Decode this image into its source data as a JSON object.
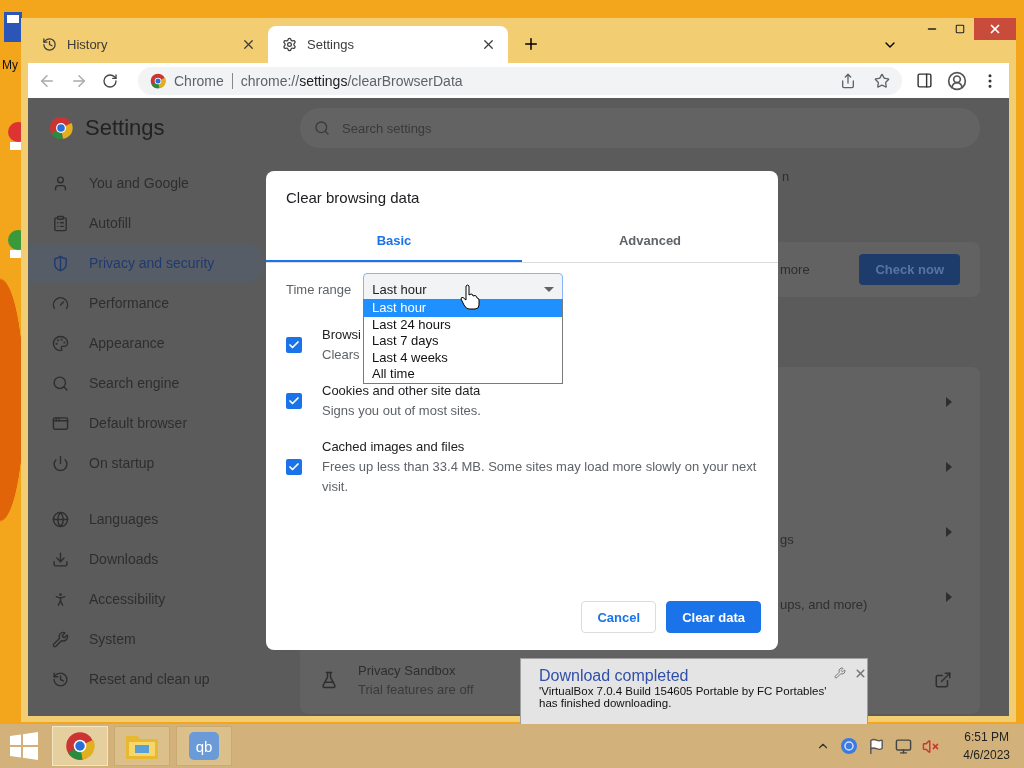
{
  "desktop": {
    "icon_label": "My"
  },
  "browser": {
    "tabs": [
      {
        "title": "History",
        "selected": false
      },
      {
        "title": "Settings",
        "selected": true
      }
    ],
    "omnibox": {
      "site": "Chrome",
      "url": "chrome://**settings**/clearBrowserData"
    }
  },
  "settings": {
    "title": "Settings",
    "search_placeholder": "Search settings",
    "sidebar_sections": [
      {
        "items": [
          {
            "label": "You and Google",
            "selected": false
          },
          {
            "label": "Autofill",
            "selected": false
          },
          {
            "label": "Privacy and security",
            "selected": true
          },
          {
            "label": "Performance",
            "selected": false
          },
          {
            "label": "Appearance",
            "selected": false
          },
          {
            "label": "Search engine",
            "selected": false
          },
          {
            "label": "Default browser",
            "selected": false
          },
          {
            "label": "On startup",
            "selected": false
          }
        ]
      },
      {
        "items": [
          {
            "label": "Languages",
            "selected": false
          },
          {
            "label": "Downloads",
            "selected": false
          },
          {
            "label": "Accessibility",
            "selected": false
          },
          {
            "label": "System",
            "selected": false
          },
          {
            "label": "Reset and clean up",
            "selected": false
          }
        ]
      }
    ],
    "top_fragment": "n",
    "safety_card": {
      "fragment": "more",
      "button": "Check now"
    },
    "rows": [
      {
        "kind": "chevron"
      },
      {
        "kind": "chevron"
      },
      {
        "kind": "chevron",
        "fragment": "gs"
      },
      {
        "kind": "chevron",
        "fragment": "ups, and more)"
      },
      {
        "kind": "external",
        "title": "Privacy Sandbox",
        "subtitle": "Trial features are off"
      }
    ]
  },
  "dialog": {
    "title": "Clear browsing data",
    "tabs": [
      {
        "label": "Basic",
        "selected": true
      },
      {
        "label": "Advanced",
        "selected": false
      }
    ],
    "time_range": {
      "label": "Time range",
      "value": "Last hour",
      "expanded": true,
      "options": [
        {
          "label": "Last hour",
          "selected": true
        },
        {
          "label": "Last 24 hours",
          "selected": false
        },
        {
          "label": "Last 7 days",
          "selected": false
        },
        {
          "label": "Last 4 weeks",
          "selected": false
        },
        {
          "label": "All time",
          "selected": false
        }
      ]
    },
    "items": [
      {
        "title": "Browsi",
        "description": "Clears",
        "checked": true
      },
      {
        "title": "Cookies and other site data",
        "description": "Signs you out of most sites.",
        "checked": true
      },
      {
        "title": "Cached images and files",
        "description": "Frees up less than 33.4 MB. Some sites may load more slowly on your next visit.",
        "checked": true
      }
    ],
    "buttons": [
      {
        "label": "Cancel",
        "kind": "secondary"
      },
      {
        "label": "Clear data",
        "kind": "primary"
      }
    ]
  },
  "notification": {
    "title": "Download completed",
    "message_lines": [
      "'VirtualBox 7.0.4 Build 154605 Portable by FC Portables'",
      "has finished downloading."
    ]
  },
  "taskbar": {
    "apps": [
      {
        "kind": "chrome",
        "selected": true
      },
      {
        "kind": "explorer",
        "selected": false
      },
      {
        "kind": "qbittorrent",
        "label": "qb",
        "selected": false
      }
    ],
    "clock": {
      "time": "6:51 PM",
      "date": "4/6/2023"
    }
  }
}
